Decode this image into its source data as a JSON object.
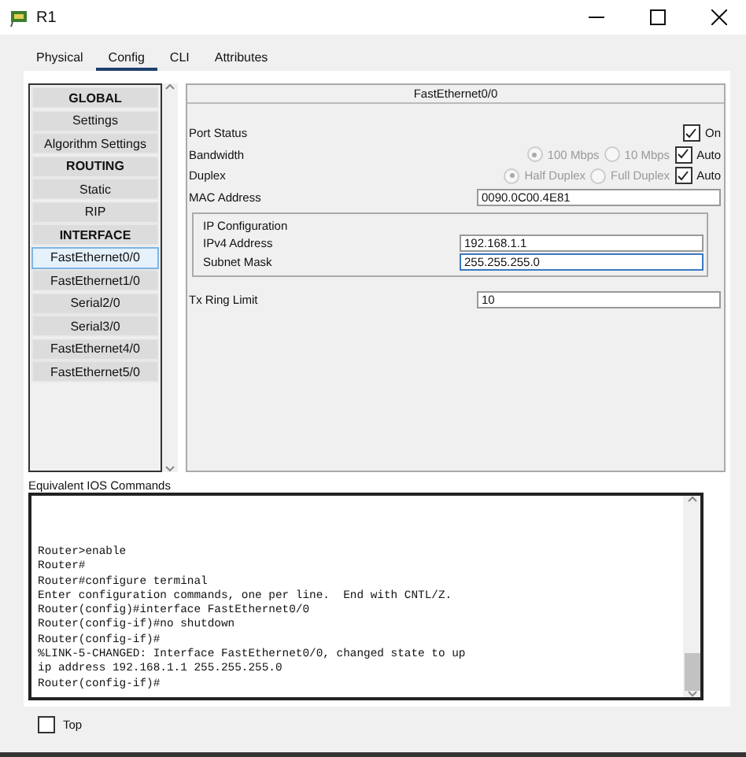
{
  "window": {
    "title": "R1"
  },
  "tabs": [
    {
      "label": "Physical",
      "selected": false
    },
    {
      "label": "Config",
      "selected": true
    },
    {
      "label": "CLI",
      "selected": false
    },
    {
      "label": "Attributes",
      "selected": false
    }
  ],
  "sidebar": {
    "items": [
      {
        "kind": "header",
        "label": "GLOBAL",
        "selected": false
      },
      {
        "kind": "item",
        "label": "Settings",
        "selected": false
      },
      {
        "kind": "item",
        "label": "Algorithm Settings",
        "selected": false
      },
      {
        "kind": "header",
        "label": "ROUTING",
        "selected": false
      },
      {
        "kind": "item",
        "label": "Static",
        "selected": false
      },
      {
        "kind": "item",
        "label": "RIP",
        "selected": false
      },
      {
        "kind": "header",
        "label": "INTERFACE",
        "selected": false
      },
      {
        "kind": "item",
        "label": "FastEthernet0/0",
        "selected": true
      },
      {
        "kind": "item",
        "label": "FastEthernet1/0",
        "selected": false
      },
      {
        "kind": "item",
        "label": "Serial2/0",
        "selected": false
      },
      {
        "kind": "item",
        "label": "Serial3/0",
        "selected": false
      },
      {
        "kind": "item",
        "label": "FastEthernet4/0",
        "selected": false
      },
      {
        "kind": "item",
        "label": "FastEthernet5/0",
        "selected": false
      }
    ]
  },
  "panel": {
    "title": "FastEthernet0/0",
    "port_status": {
      "label": "Port Status",
      "option": {
        "label": "On",
        "checked": true
      }
    },
    "bandwidth": {
      "label": "Bandwidth",
      "radios": [
        {
          "label": "100 Mbps",
          "selected": true
        },
        {
          "label": "10 Mbps",
          "selected": false
        }
      ],
      "auto": {
        "label": "Auto",
        "checked": true
      }
    },
    "duplex": {
      "label": "Duplex",
      "radios": [
        {
          "label": "Half Duplex",
          "selected": true
        },
        {
          "label": "Full Duplex",
          "selected": false
        }
      ],
      "auto": {
        "label": "Auto",
        "checked": true
      }
    },
    "mac": {
      "label": "MAC Address",
      "value": "0090.0C00.4E81"
    },
    "ip_config": {
      "title": "IP Configuration",
      "fields": [
        {
          "label": "IPv4 Address",
          "value": "192.168.1.1"
        },
        {
          "label": "Subnet Mask",
          "value": "255.255.255.0"
        }
      ]
    },
    "tx_ring": {
      "label": "Tx Ring Limit",
      "value": "10"
    }
  },
  "console": {
    "label": "Equivalent IOS Commands",
    "lines": [
      "Router>enable",
      "Router#",
      "Router#configure terminal",
      "Enter configuration commands, one per line.  End with CNTL/Z.",
      "Router(config)#interface FastEthernet0/0",
      "Router(config-if)#no shutdown",
      "Router(config-if)#",
      "%LINK-5-CHANGED: Interface FastEthernet0/0, changed state to up",
      "ip address 192.168.1.1 255.255.255.0",
      "Router(config-if)#"
    ]
  },
  "top": {
    "label": "Top",
    "checked": false
  }
}
